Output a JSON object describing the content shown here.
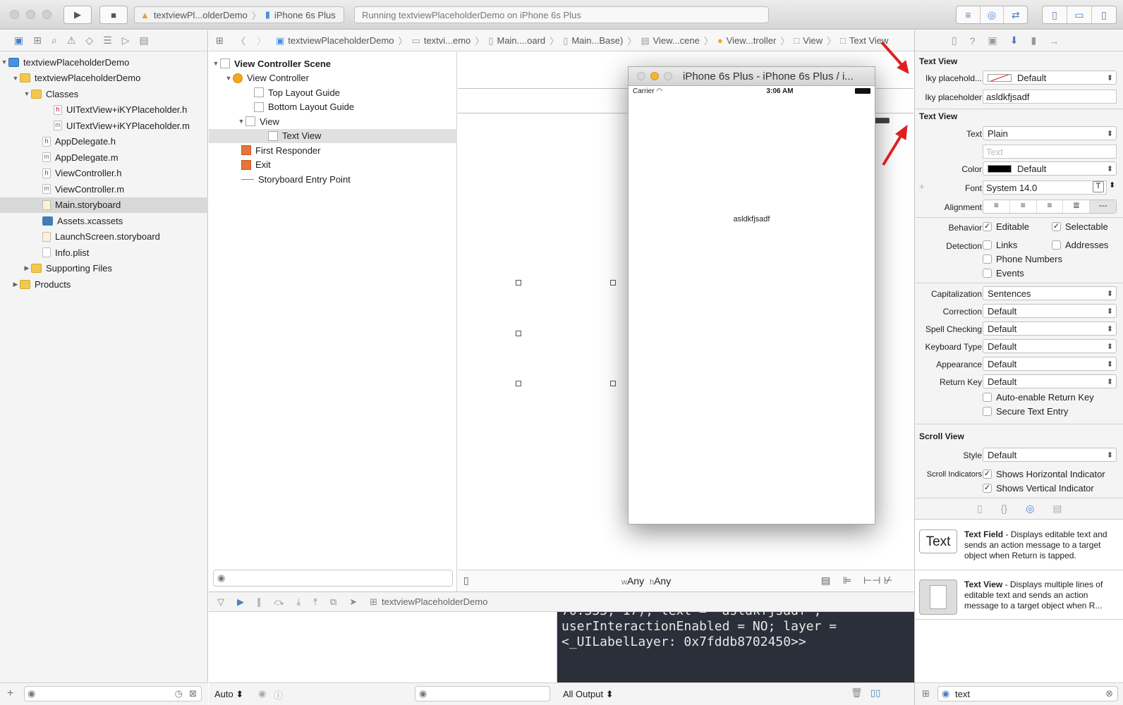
{
  "toolbar": {
    "scheme_target": "textviewPl...olderDemo",
    "scheme_device": "iPhone 6s Plus",
    "activity_text": "Running textviewPlaceholderDemo on iPhone 6s Plus"
  },
  "navigator": {
    "items": [
      {
        "label": "textviewPlaceholderDemo",
        "kind": "project"
      },
      {
        "label": "textviewPlaceholderDemo",
        "kind": "folder"
      },
      {
        "label": "Classes",
        "kind": "folder"
      },
      {
        "label": "UITextView+iKYPlaceholder.h",
        "kind": "h"
      },
      {
        "label": "UITextView+iKYPlaceholder.m",
        "kind": "m"
      },
      {
        "label": "AppDelegate.h",
        "kind": "h"
      },
      {
        "label": "AppDelegate.m",
        "kind": "m"
      },
      {
        "label": "ViewController.h",
        "kind": "h"
      },
      {
        "label": "ViewController.m",
        "kind": "m"
      },
      {
        "label": "Main.storyboard",
        "kind": "storyboard"
      },
      {
        "label": "Assets.xcassets",
        "kind": "assets"
      },
      {
        "label": "LaunchScreen.storyboard",
        "kind": "storyboard"
      },
      {
        "label": "Info.plist",
        "kind": "plist"
      },
      {
        "label": "Supporting Files",
        "kind": "folder"
      },
      {
        "label": "Products",
        "kind": "folder"
      }
    ]
  },
  "jumpbar": {
    "crumbs": [
      "textviewPlaceholderDemo",
      "textvi...emo",
      "Main....oard",
      "Main...Base)",
      "View...cene",
      "View...troller",
      "View",
      "Text View"
    ]
  },
  "outline": {
    "items": [
      "View Controller Scene",
      "View Controller",
      "Top Layout Guide",
      "Bottom Layout Guide",
      "View",
      "Text View",
      "First Responder",
      "Exit",
      "Storyboard Entry Point"
    ]
  },
  "canvas": {
    "size_class_w": "Any",
    "size_class_h": "Any",
    "w_prefix": "w",
    "h_prefix": "h"
  },
  "simulator": {
    "title": "iPhone 6s Plus - iPhone 6s Plus / i...",
    "carrier": "Carrier",
    "time": "3:06 AM",
    "placeholder_text": "asldkfjsadf"
  },
  "debug": {
    "target": "textviewPlaceholderDemo",
    "console_lines": [
      "70.333; 17); text = 'asldkfjsadf';",
      "userInteractionEnabled = NO; layer =",
      "<_UILabelLayer: 0x7fddb8702450>>"
    ],
    "auto_label": "Auto",
    "output_label": "All Output"
  },
  "inspector": {
    "section1_title": "Text View",
    "iky_label1": "Iky placehold...",
    "iky_color_value": "Default",
    "iky_label2": "Iky placeholder",
    "iky_text_value": "asldkfjsadf",
    "section2_title": "Text View",
    "text_label": "Text",
    "text_value": "Plain",
    "text_placeholder": "Text",
    "color_label": "Color",
    "color_value": "Default",
    "font_label": "Font",
    "font_value": "System 14.0",
    "alignment_label": "Alignment",
    "behavior_label": "Behavior",
    "editable_label": "Editable",
    "selectable_label": "Selectable",
    "detection_label": "Detection",
    "links_label": "Links",
    "addresses_label": "Addresses",
    "phone_label": "Phone Numbers",
    "events_label": "Events",
    "capitalization_label": "Capitalization",
    "capitalization_value": "Sentences",
    "correction_label": "Correction",
    "correction_value": "Default",
    "spell_label": "Spell Checking",
    "spell_value": "Default",
    "keyboard_label": "Keyboard Type",
    "keyboard_value": "Default",
    "appearance_label": "Appearance",
    "appearance_value": "Default",
    "return_label": "Return Key",
    "return_value": "Default",
    "auto_return_label": "Auto-enable Return Key",
    "secure_label": "Secure Text Entry",
    "section3_title": "Scroll View",
    "style_label": "Style",
    "style_value": "Default",
    "indicators_label": "Scroll Indicators",
    "horiz_label": "Shows Horizontal Indicator",
    "vert_label": "Shows Vertical Indicator"
  },
  "library": {
    "item1_icon_text": "Text",
    "item1_name": "Text Field",
    "item1_desc": " - Displays editable text and sends an action message to a target object when Return is tapped.",
    "item2_name": "Text View",
    "item2_desc": " - Displays multiple lines of editable text and sends an action message to a target object when R...",
    "search_value": "text"
  },
  "colors": {
    "accent": "#4a7fc1",
    "annotation_arrow": "#e02020",
    "console_bg": "#2b2f3a"
  }
}
